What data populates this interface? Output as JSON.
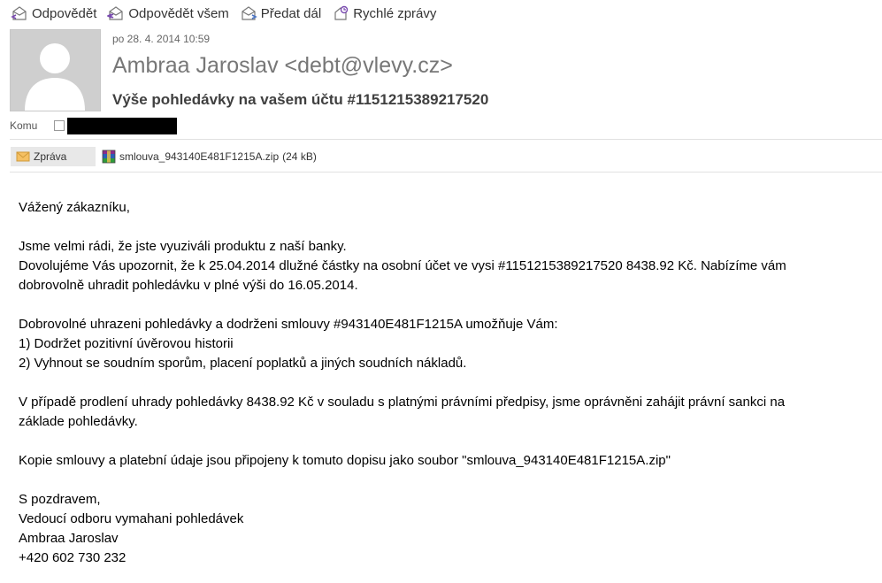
{
  "toolbar": {
    "reply": "Odpovědět",
    "reply_all": "Odpovědět všem",
    "forward": "Předat dál",
    "quick_messages": "Rychlé zprávy"
  },
  "header": {
    "date": "po 28. 4. 2014 10:59",
    "sender": "Ambraa Jaroslav <debt@vlevy.cz>",
    "subject": "Výše pohledávky na vašem účtu #1151215389217520",
    "to_label": "Komu"
  },
  "attachments": {
    "message_tab": "Zpráva",
    "file_name": "smlouva_943140E481F1215A.zip",
    "file_size": "(24 kB)"
  },
  "body": {
    "greeting": "Vážený zákazníku,",
    "p1_l1": "Jsme velmi rádi, že jste vyuziváli produktu z naší banky.",
    "p1_l2": "Dovolujéme Vás upozornit, že k 25.04.2014 dlužné částky na osobní účet ve vysi #1151215389217520 8438.92 Kč. Nabízíme vám",
    "p1_l3": "dobrovolně uhradit pohledávku v plné výši do 16.05.2014.",
    "p2_l1": "Dobrovolné uhrazeni pohledávky a dodrženi smlouvy #943140E481F1215A umožňuje Vám:",
    "p2_l2": "1) Dodržet pozitivní úvěrovou historii",
    "p2_l3": "2) Vyhnout se soudním sporům, placení poplatků a jiných soudních nákladů.",
    "p3_l1": "V případě prodlení uhrady pohledávky 8438.92 Kč v souladu s platnými právními předpisy, jsme oprávněni zahájit právní sankci na",
    "p3_l2": "základe pohledávky.",
    "p4_l1": "Kopie smlouvy a platební údaje jsou připojeny k tomuto dopisu jako soubor \"smlouva_943140E481F1215A.zip\"",
    "sign_l1": "S pozdravem,",
    "sign_l2": "Vedoucí odboru vymahani pohledávek",
    "sign_l3": "Ambraa Jaroslav",
    "sign_l4": "+420 602 730 232"
  }
}
